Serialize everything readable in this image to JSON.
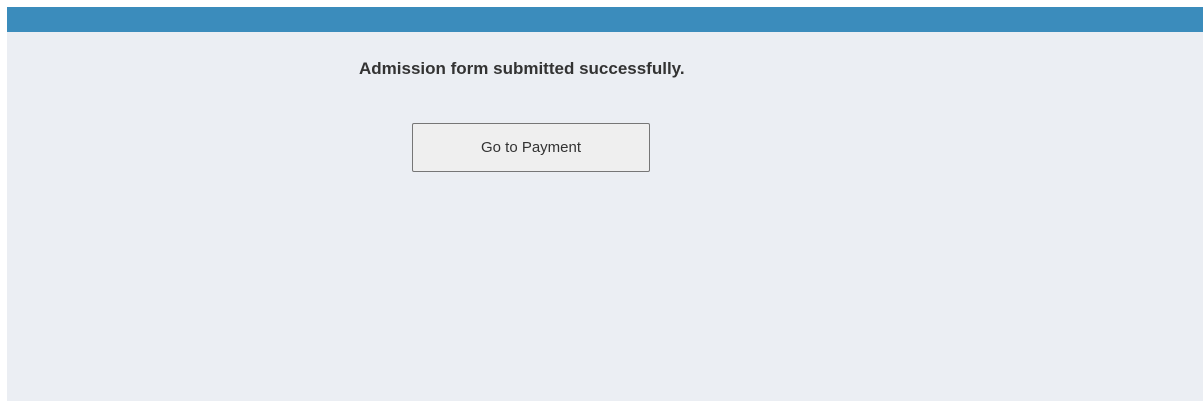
{
  "page": {
    "message": "Admission form submitted successfully.",
    "button_label": "Go to Payment"
  },
  "colors": {
    "top_bar": "#3b8cbc",
    "background": "#ebeef3",
    "button_background": "#efefef",
    "text": "#333333"
  }
}
